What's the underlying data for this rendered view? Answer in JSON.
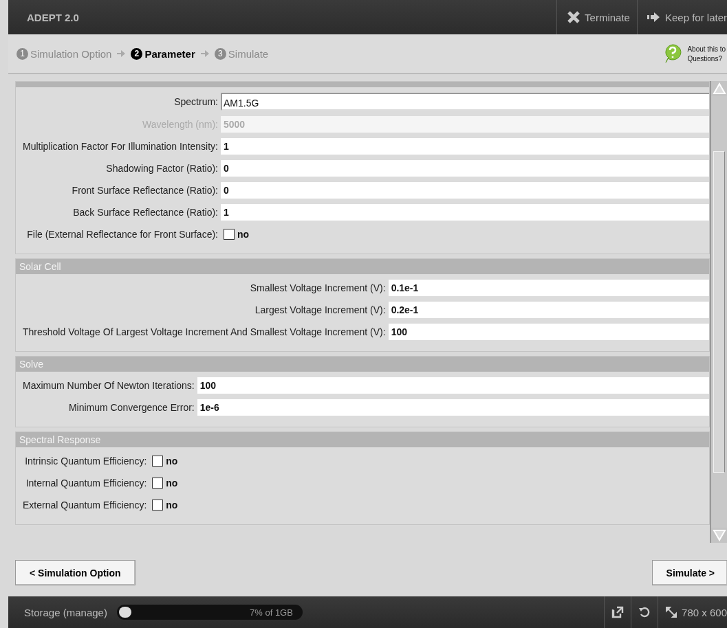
{
  "window": {
    "title": "ADEPT 2.0"
  },
  "header_actions": [
    {
      "label": "Terminate",
      "kind": "terminate"
    },
    {
      "label": "Keep for later",
      "kind": "keep"
    }
  ],
  "steps": [
    {
      "number": "1",
      "label": "Simulation Option",
      "selected": false
    },
    {
      "number": "2",
      "label": "Parameter",
      "selected": true
    },
    {
      "number": "3",
      "label": "Simulate",
      "selected": false
    }
  ],
  "help": {
    "lines": [
      "About this to",
      "Questions?"
    ]
  },
  "sections": [
    {
      "fields": [
        {
          "kind": "select",
          "label": "Spectrum:",
          "value": "AM1.5G",
          "disabled": false
        },
        {
          "kind": "text",
          "label": "Wavelength (nm):",
          "value": "5000",
          "disabled": true
        },
        {
          "kind": "text",
          "label": "Multiplication Factor For Illumination Intensity:",
          "value": "1",
          "disabled": false
        },
        {
          "kind": "text",
          "label": "Shadowing Factor (Ratio):",
          "value": "0",
          "disabled": false
        },
        {
          "kind": "text",
          "label": "Front Surface Reflectance (Ratio):",
          "value": "0",
          "disabled": false
        },
        {
          "kind": "text",
          "label": "Back Surface Reflectance (Ratio):",
          "value": "1",
          "disabled": false
        },
        {
          "kind": "checkbox",
          "label": "File (External Reflectance for Front Surface):",
          "value": "no",
          "checked": false
        }
      ]
    },
    {
      "title": "Solar Cell",
      "fields": [
        {
          "kind": "text",
          "label": "Smallest Voltage Increment (V):",
          "value": "0.1e-1",
          "disabled": false
        },
        {
          "kind": "text",
          "label": "Largest Voltage Increment (V):",
          "value": "0.2e-1",
          "disabled": false
        },
        {
          "kind": "text",
          "label": "Threshold Voltage Of Largest Voltage Increment And Smallest Voltage Increment (V):",
          "value": "100",
          "disabled": false
        }
      ]
    },
    {
      "title": "Solve",
      "fields": [
        {
          "kind": "text",
          "label": "Maximum Number Of Newton Iterations:",
          "value": "100",
          "disabled": false
        },
        {
          "kind": "text",
          "label": "Minimum Convergence Error:",
          "value": "1e-6",
          "disabled": false
        }
      ]
    },
    {
      "title": "Spectral Response",
      "fields": [
        {
          "kind": "checkbox",
          "label": "Intrinsic Quantum Efficiency:",
          "value": "no",
          "checked": false
        },
        {
          "kind": "checkbox",
          "label": "Internal Quantum Efficiency:",
          "value": "no",
          "checked": false
        },
        {
          "kind": "checkbox",
          "label": "External Quantum Efficiency:",
          "value": "no",
          "checked": false
        }
      ]
    }
  ],
  "buttons": {
    "back": "< Simulation Option",
    "next": "Simulate >"
  },
  "status_bar": {
    "storage_label": "Storage (manage)",
    "storage": {
      "level": 0.07,
      "reading": "7% of 1GB"
    },
    "size": "780 x 600"
  }
}
